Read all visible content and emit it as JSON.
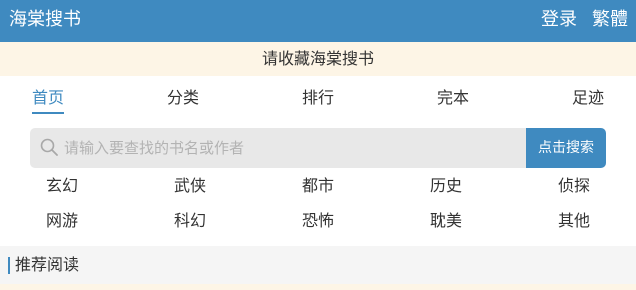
{
  "header": {
    "site_title": "海棠搜书",
    "login": "登录",
    "traditional": "繁體"
  },
  "notice": "请收藏海棠搜书",
  "nav": {
    "items": [
      {
        "label": "首页",
        "active": true
      },
      {
        "label": "分类"
      },
      {
        "label": "排行"
      },
      {
        "label": "完本"
      },
      {
        "label": "足迹"
      }
    ]
  },
  "search": {
    "placeholder": "请输入要查找的书名或作者",
    "button": "点击搜索"
  },
  "categories": [
    [
      "玄幻",
      "武侠",
      "都市",
      "历史",
      "侦探"
    ],
    [
      "网游",
      "科幻",
      "恐怖",
      "耽美",
      "其他"
    ]
  ],
  "recommend": {
    "title": "推荐阅读"
  },
  "colors": {
    "accent": "#3f8ac0",
    "notice_bg": "#fdf5e6",
    "section_bg": "#f5f5f5"
  }
}
